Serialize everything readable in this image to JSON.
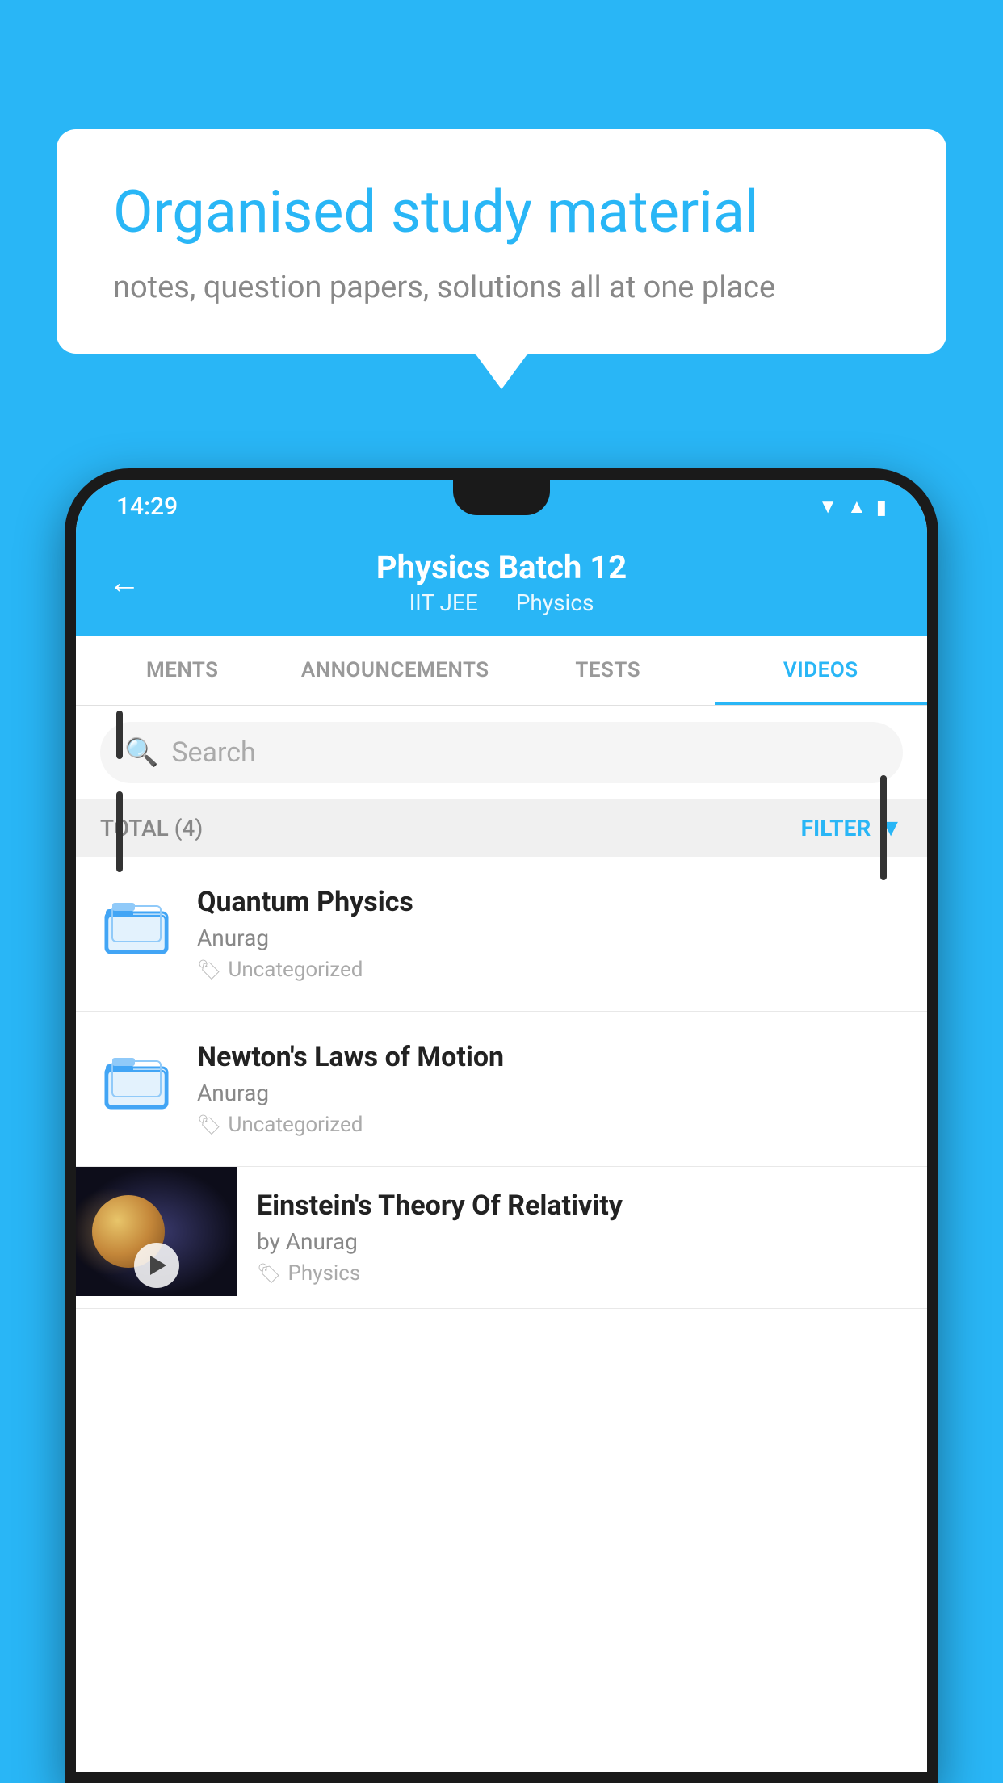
{
  "background": {
    "color": "#29b6f6"
  },
  "speech_bubble": {
    "title": "Organised study material",
    "subtitle": "notes, question papers, solutions all at one place"
  },
  "phone": {
    "status_bar": {
      "time": "14:29",
      "icons": [
        "wifi",
        "signal",
        "battery"
      ]
    },
    "header": {
      "back_label": "←",
      "title": "Physics Batch 12",
      "subtitle1": "IIT JEE",
      "subtitle2": "Physics"
    },
    "tabs": [
      {
        "label": "MENTS",
        "active": false
      },
      {
        "label": "ANNOUNCEMENTS",
        "active": false
      },
      {
        "label": "TESTS",
        "active": false
      },
      {
        "label": "VIDEOS",
        "active": true
      }
    ],
    "search": {
      "placeholder": "Search"
    },
    "filter_row": {
      "total_label": "TOTAL (4)",
      "filter_label": "FILTER"
    },
    "items": [
      {
        "type": "folder",
        "title": "Quantum Physics",
        "author": "Anurag",
        "tag": "Uncategorized"
      },
      {
        "type": "folder",
        "title": "Newton's Laws of Motion",
        "author": "Anurag",
        "tag": "Uncategorized"
      },
      {
        "type": "video",
        "title": "Einstein's Theory Of Relativity",
        "author": "by Anurag",
        "tag": "Physics"
      }
    ]
  }
}
